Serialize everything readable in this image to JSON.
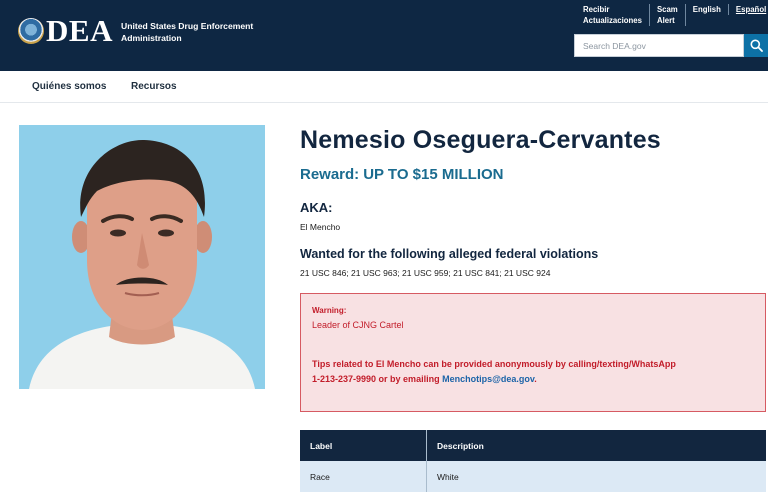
{
  "header": {
    "logo": "DEA",
    "agency_line1": "United States Drug Enforcement",
    "agency_line2": "Administration",
    "util": {
      "receive_line1": "Recibir",
      "receive_line2": "Actualizaciones",
      "scam_line1": "Scam",
      "scam_line2": "Alert",
      "english": "English",
      "espanol": "Español"
    },
    "search_placeholder": "Search DEA.gov",
    "search_icon": "search-icon"
  },
  "subnav": {
    "items": [
      "Quiénes somos",
      "Recursos"
    ]
  },
  "profile": {
    "name": "Nemesio Oseguera-Cervantes",
    "reward_label": "Reward:",
    "reward_value": "UP TO $15 MILLION",
    "aka_heading": "AKA:",
    "aka_value": "El Mencho",
    "violations_heading": "Wanted for the following alleged federal violations",
    "violations_value": "21 USC 846; 21 USC 963; 21 USC 959; 21 USC 841; 21 USC 924"
  },
  "warning": {
    "label": "Warning:",
    "text": "Leader of CJNG Cartel",
    "tips_part1": "Tips related to El Mencho can be provided anonymously by calling/texting/WhatsApp",
    "tips_part2": "1-213-237-9990 or by emailing ",
    "email": "Menchotips@dea.gov",
    "tips_end": "."
  },
  "table": {
    "headers": [
      "Label",
      "Description"
    ],
    "rows": [
      {
        "label": "Race",
        "description": "White"
      }
    ]
  },
  "colors": {
    "header_bg": "#0e2743",
    "accent_blue": "#1a6b8f",
    "warning_bg": "#f8e1e3",
    "warning_text": "#c21d2a",
    "table_head": "#12263f",
    "table_row": "#dce9f5"
  }
}
